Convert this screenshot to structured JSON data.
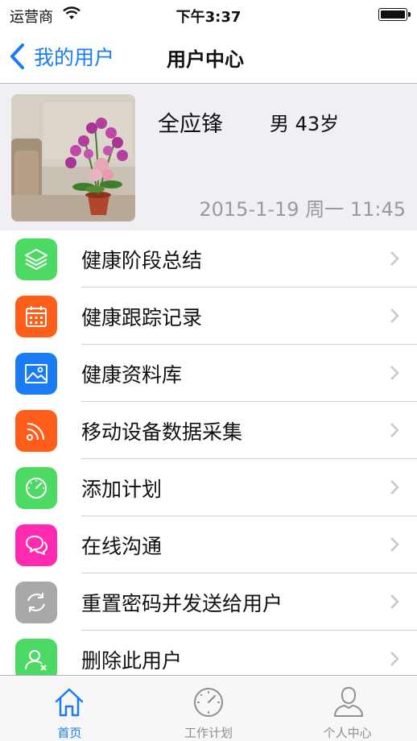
{
  "status_bar": {
    "carrier": "运营商",
    "time": "下午3:37"
  },
  "nav": {
    "back_label": "我的用户",
    "title": "用户中心"
  },
  "profile": {
    "name": "全应锋",
    "gender_age": "男 43岁",
    "datetime": "2015-1-19 周一 11:45"
  },
  "menu": {
    "items": [
      {
        "label": "健康阶段总结",
        "icon": "layers-icon",
        "color": "#4cd964"
      },
      {
        "label": "健康跟踪记录",
        "icon": "calendar-icon",
        "color": "#ff5e1a"
      },
      {
        "label": "健康资料库",
        "icon": "image-icon",
        "color": "#1a7cf5"
      },
      {
        "label": "移动设备数据采集",
        "icon": "rss-icon",
        "color": "#ff5e1a"
      },
      {
        "label": "添加计划",
        "icon": "speedometer-icon",
        "color": "#4cd964"
      },
      {
        "label": "在线沟通",
        "icon": "chat-icon",
        "color": "#ff2ab0"
      },
      {
        "label": "重置密码并发送给用户",
        "icon": "refresh-icon",
        "color": "#a8a8a8"
      },
      {
        "label": "删除此用户",
        "icon": "remove-user-icon",
        "color": "#4cd964"
      }
    ]
  },
  "tabs": [
    {
      "label": "首页",
      "icon": "home-icon",
      "active": true
    },
    {
      "label": "工作计划",
      "icon": "speedometer-icon",
      "active": false
    },
    {
      "label": "个人中心",
      "icon": "person-icon",
      "active": false
    }
  ],
  "colors": {
    "accent": "#1a7cf5",
    "profile_bg": "#efeff4"
  }
}
